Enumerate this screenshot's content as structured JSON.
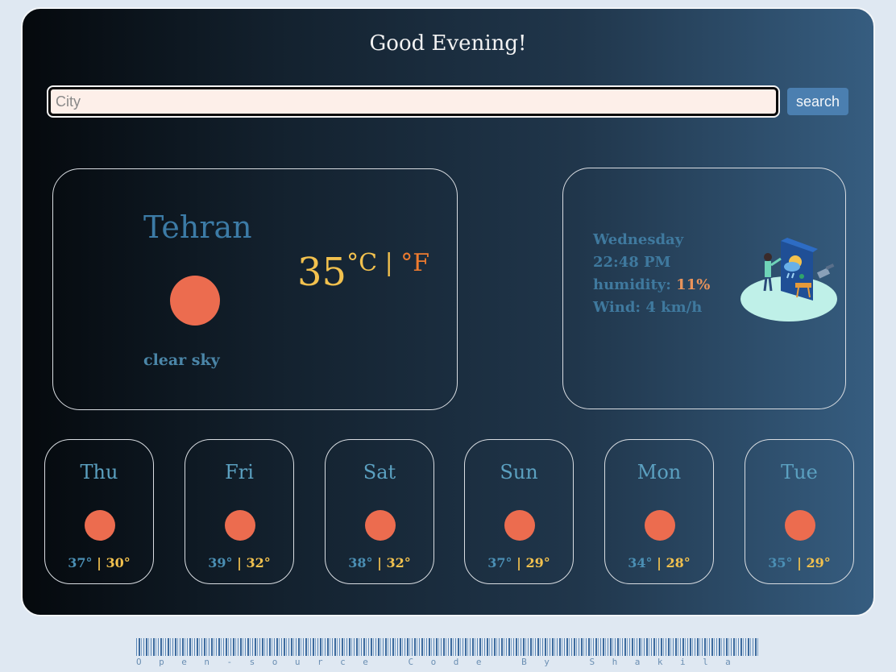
{
  "header": {
    "greeting": "Good Evening!"
  },
  "search": {
    "placeholder": "City",
    "value": "",
    "button_label": "search"
  },
  "current": {
    "city": "Tehran",
    "temp": "35",
    "unit_c": "°C",
    "unit_sep": " | ",
    "unit_f": "°F",
    "description": "clear sky",
    "icon": "sun-icon"
  },
  "info": {
    "day": "Wednesday",
    "time": "22:48 PM",
    "humidity_label": "humidity: ",
    "humidity_value": "11%",
    "wind": "Wind: 4 km/h",
    "illustration": "weather-illustration"
  },
  "forecast": [
    {
      "day": "Thu",
      "high": "37°",
      "low": "30°"
    },
    {
      "day": "Fri",
      "high": "39°",
      "low": "32°"
    },
    {
      "day": "Sat",
      "high": "38°",
      "low": "32°"
    },
    {
      "day": "Sun",
      "high": "37°",
      "low": "29°"
    },
    {
      "day": "Mon",
      "high": "34°",
      "low": "28°"
    },
    {
      "day": "Tue",
      "high": "35°",
      "low": "29°"
    }
  ],
  "footer": {
    "credit": "Open-source Code By Shakila"
  },
  "colors": {
    "accent": "#4b7fb0",
    "sun": "#ec6c4f",
    "temp": "#f2c14e",
    "fahrenheit": "#ee7b2f"
  }
}
